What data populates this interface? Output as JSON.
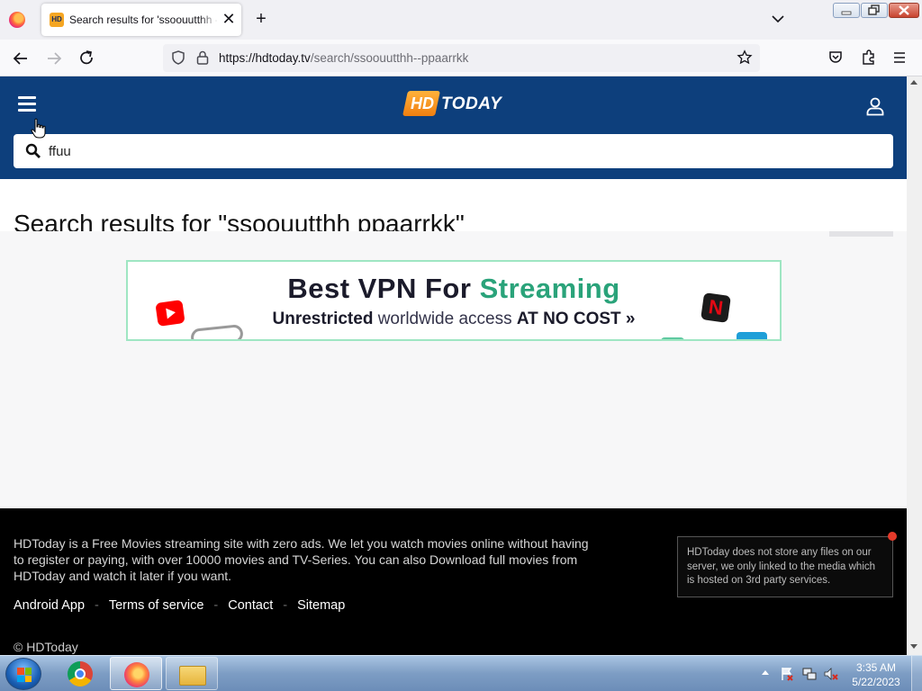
{
  "browser": {
    "tab_title": "Search results for 'ssoouutthh --ppaarrkk'",
    "tab_favicon_text": "HD",
    "url_host": "https://hdtoday.tv",
    "url_path": "/search/ssoouutthh--ppaarrkk"
  },
  "site": {
    "logo_hd": "HD",
    "logo_today": "TODAY",
    "search_value": "ffuu",
    "results_heading": "Search results for \"ssoouutthh ppaarrkk\""
  },
  "ad": {
    "title_main": "Best VPN For",
    "title_accent": "Streaming",
    "sub_plain_1": "Unrestricted",
    "sub_plain_2": " worldwide access ",
    "sub_bold": "AT NO COST",
    "sub_arrow": " »",
    "netflix_letter": "N",
    "accent_color": "#2aa37a"
  },
  "footer": {
    "about": "HDToday is a Free Movies streaming site with zero ads. We let you watch movies online without having to register or paying, with over 10000 movies and TV-Series. You can also Download full movies from HDToday and watch it later if you want.",
    "links": {
      "android": "Android App",
      "terms": "Terms of service",
      "contact": "Contact",
      "sitemap": "Sitemap",
      "separator": "-"
    },
    "copyright": "© HDToday",
    "disclaimer": "HDToday does not store any files on our server, we only linked to the media which is hosted on 3rd party services."
  },
  "taskbar": {
    "time": "3:35 AM",
    "date": "5/22/2023"
  },
  "colors": {
    "header_blue": "#0d3f7c",
    "footer_black": "#000000"
  }
}
